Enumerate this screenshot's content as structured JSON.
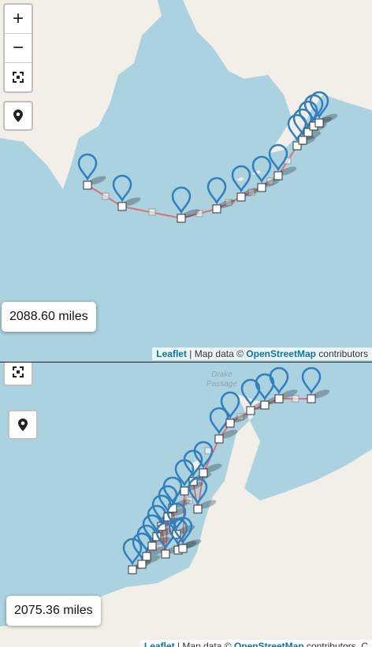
{
  "top_map": {
    "distance_label": "2088.60 miles",
    "attribution": {
      "leaflet": "Leaflet",
      "separator": " | Map data © ",
      "osm": "OpenStreetMap",
      "suffix": " contributors"
    },
    "controls": {
      "zoom_in": "+",
      "zoom_out": "−",
      "fullscreen_icon": "fullscreen-icon",
      "locate_icon": "map-pin-icon"
    }
  },
  "bottom_map": {
    "distance_label": "2075.36 miles",
    "place_label": "Drake\nPassage",
    "attribution": {
      "leaflet": "Leaflet",
      "separator": " | Map data © ",
      "osm": "OpenStreetMap",
      "suffix": " contributors, C"
    },
    "controls": {
      "fullscreen_icon": "fullscreen-icon",
      "locate_icon": "map-pin-icon"
    }
  },
  "colors": {
    "water": "#aad3df",
    "land": "#f2efe9",
    "route": "#e06060",
    "marker": "#2f7fbf"
  }
}
